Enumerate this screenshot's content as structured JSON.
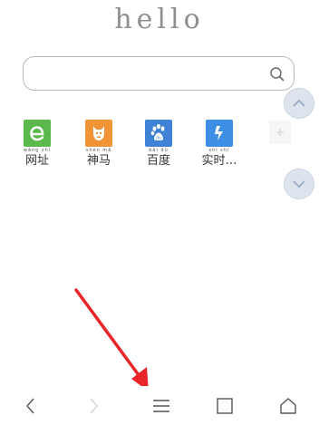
{
  "logo": {
    "text": "hello"
  },
  "search": {
    "value": "",
    "placeholder": ""
  },
  "shortcuts": [
    {
      "label": "网址",
      "pinyin": "wǎng zhǐ",
      "icon": "e-letter-icon",
      "color": "#5ab94a"
    },
    {
      "label": "神马",
      "pinyin": "shén mǎ",
      "icon": "horse-head-icon",
      "color": "#f19438"
    },
    {
      "label": "百度",
      "pinyin": "bǎi dù",
      "icon": "paw-icon",
      "color": "#3f82d6"
    },
    {
      "label": "实时…",
      "pinyin": "shí shí",
      "icon": "lightning-icon",
      "color": "#3c8fe4"
    }
  ],
  "colors": {
    "arrow": "#e8262a",
    "scroll_buttons": "#dde4ee"
  },
  "bottom_nav": [
    "back-icon",
    "forward-icon",
    "menu-icon",
    "tabs-icon",
    "home-icon"
  ]
}
